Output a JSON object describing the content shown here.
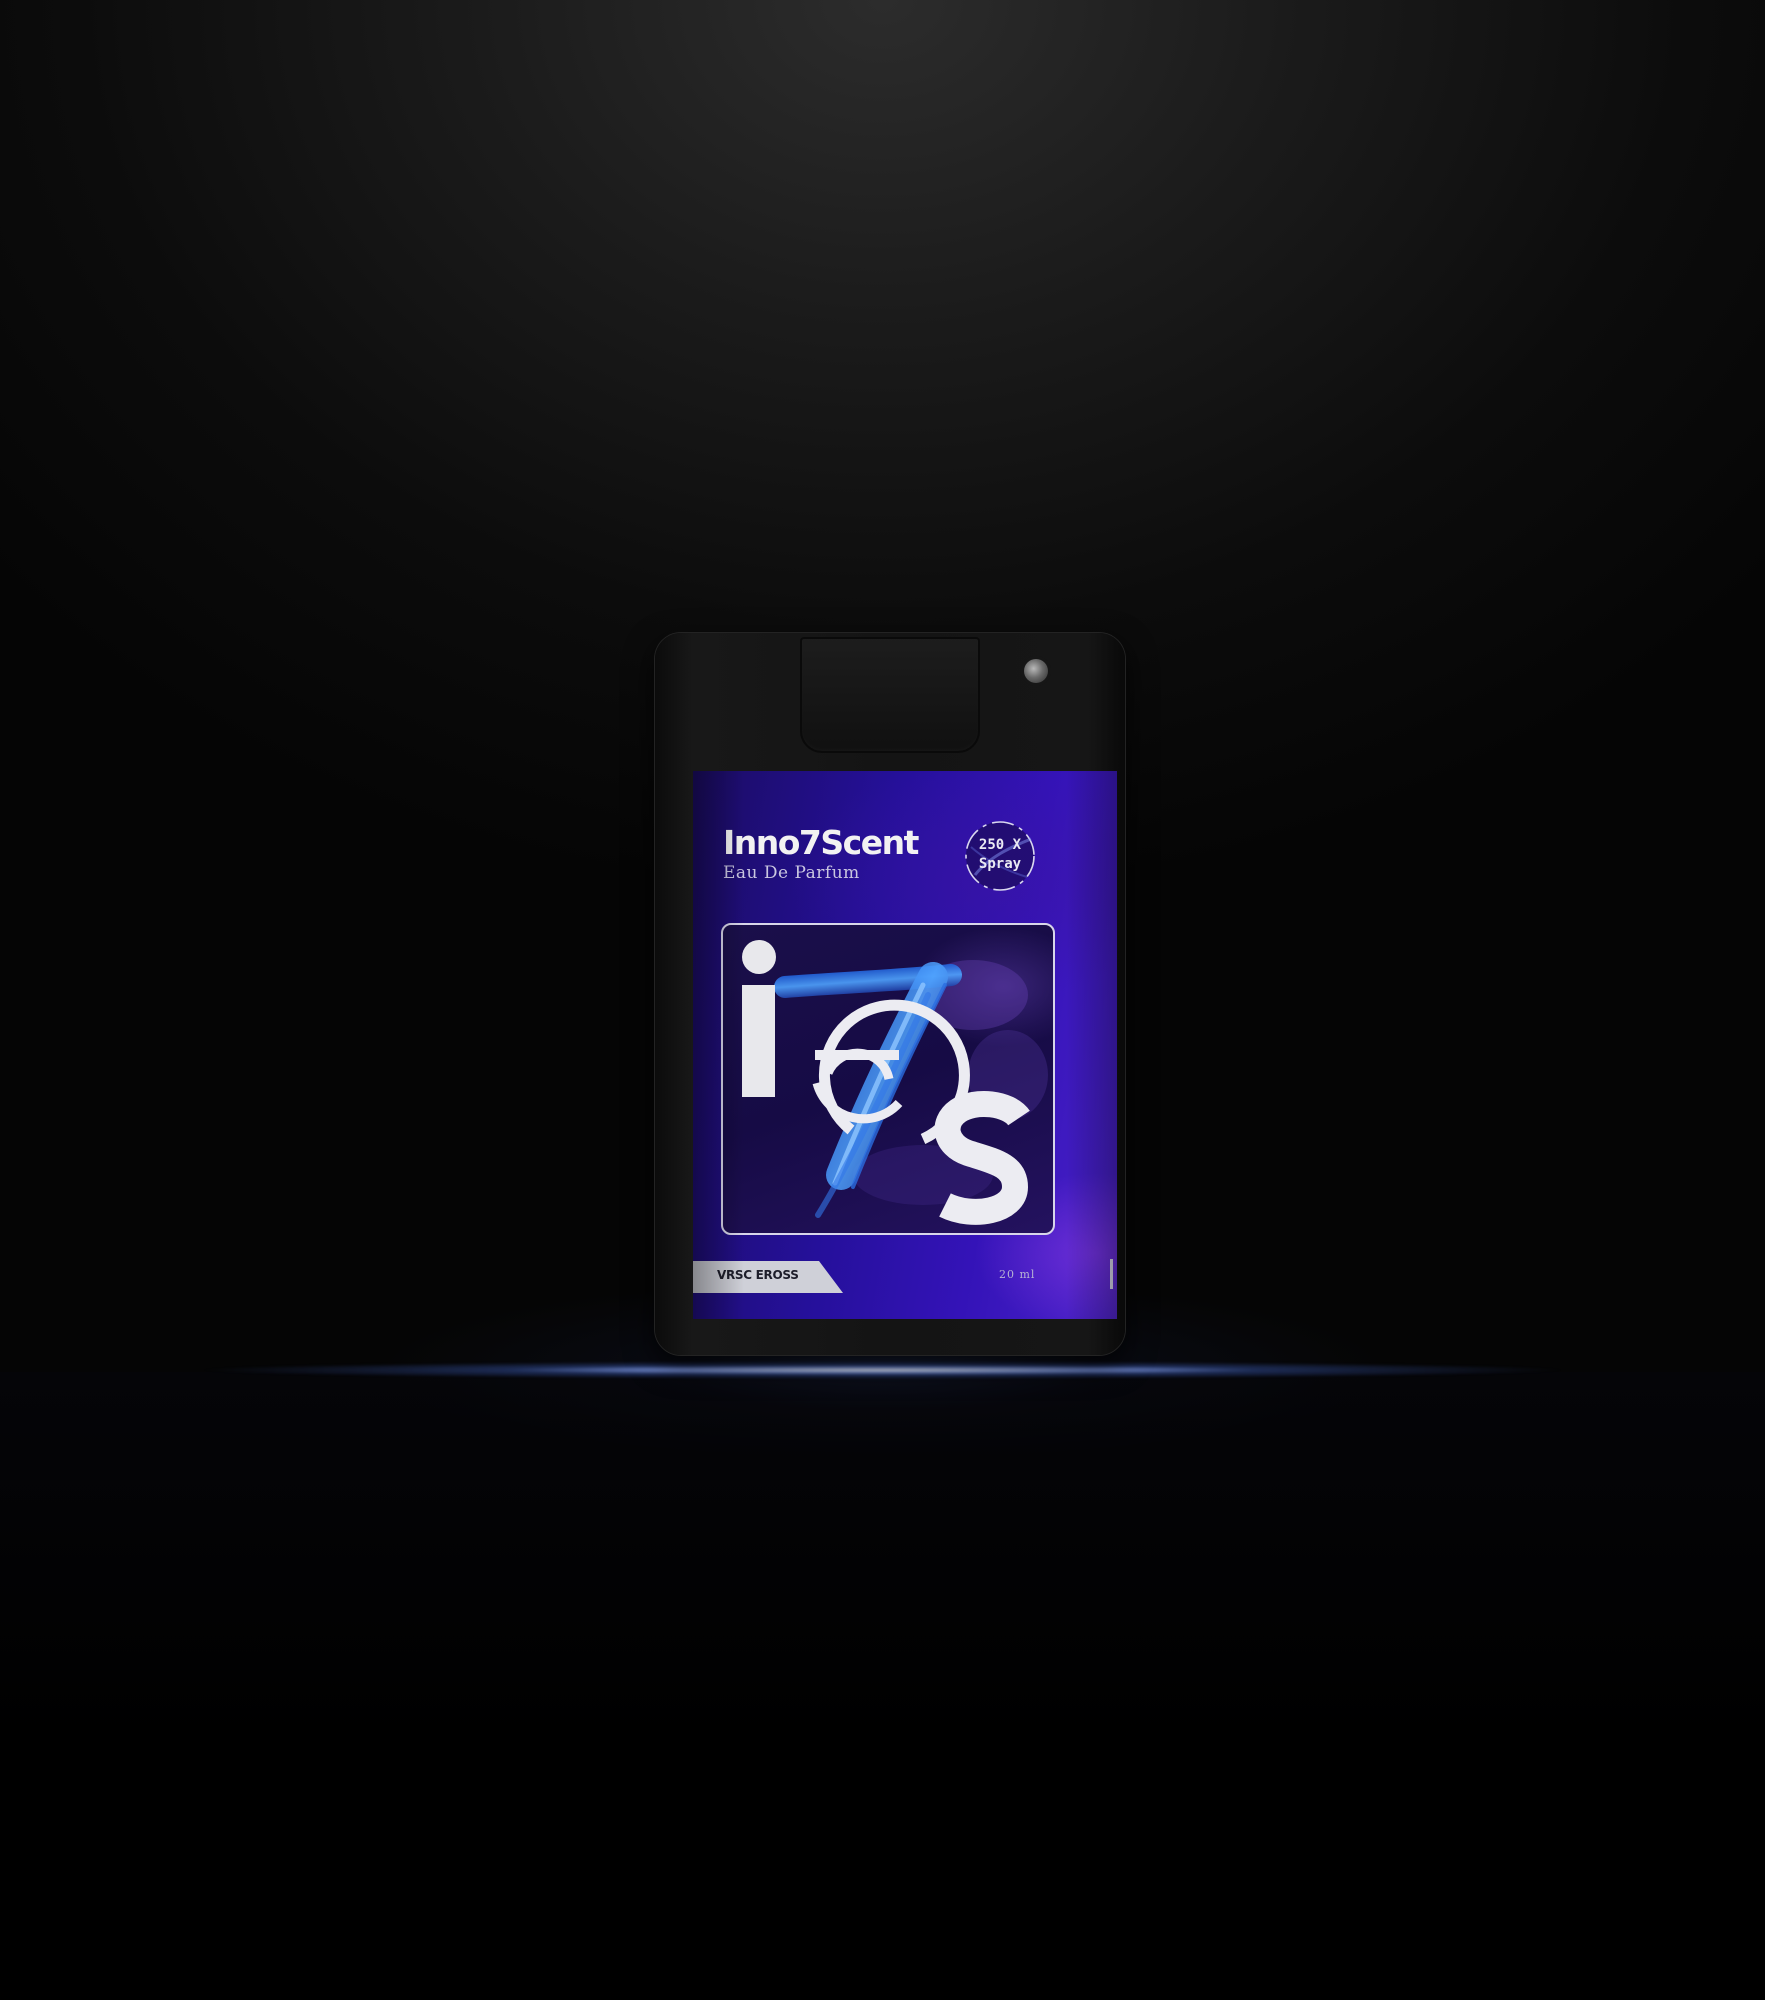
{
  "product": {
    "brand": "Inno7Scent",
    "type": "Eau De Parfum",
    "spray_count": "250 X",
    "spray_word": "Spray",
    "variant": "VRSC EROSS",
    "volume": "20 ml"
  },
  "colors": {
    "background": "#1b1b1b",
    "label_purple": "#2a12a8",
    "glow": "#9db4ff",
    "bottle_black": "#141414"
  },
  "icons": {
    "logo": "ios-monogram-logo",
    "badge": "spray-count-badge"
  }
}
